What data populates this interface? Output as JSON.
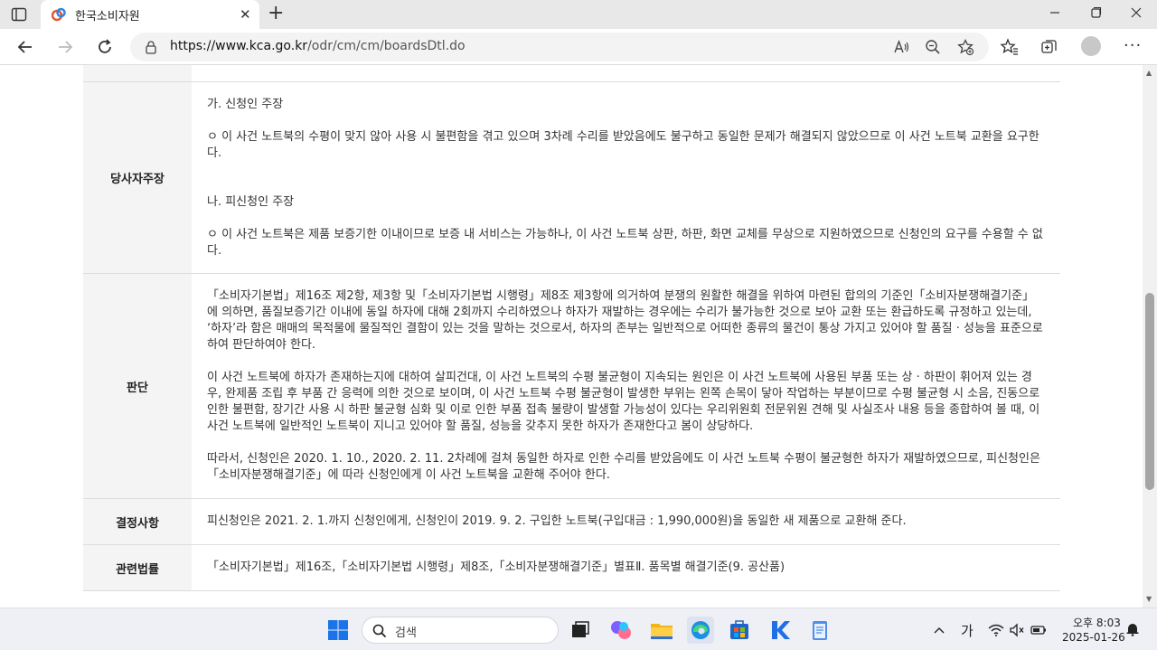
{
  "browser": {
    "tab_title": "한국소비자원",
    "tab_close": "✕",
    "new_tab": "+",
    "url_domain": "https://www.kca.go.kr",
    "url_path": "/odr/cm/cm/boardsDtl.do",
    "more": "···"
  },
  "table": {
    "rows": [
      {
        "label": "당사자주장",
        "paragraphs": [
          "가. 신청인 주장",
          "ㅇ 이 사건 노트북의 수평이 맞지 않아 사용 시 불편함을 겪고 있으며 3차례 수리를 받았음에도 불구하고 동일한 문제가 해결되지 않았으므로 이 사건 노트북 교환을 요구한다.",
          "나. 피신청인 주장",
          "ㅇ 이 사건 노트북은 제품 보증기한 이내이므로 보증 내 서비스는 가능하나, 이 사건 노트북 상판, 하판, 화면 교체를 무상으로 지원하였으므로 신청인의 요구를 수용할 수 없다."
        ]
      },
      {
        "label": "판단",
        "paragraphs": [
          "「소비자기본법」제16조 제2항, 제3항 및「소비자기본법 시행령」제8조 제3항에 의거하여 분쟁의 원활한 해결을 위하여 마련된 합의의 기준인「소비자분쟁해결기준」에 의하면, 품질보증기간 이내에 동일 하자에 대해 2회까지 수리하였으나 하자가 재발하는 경우에는 수리가 불가능한 것으로 보아 교환 또는 환급하도록 규정하고 있는데, ‘하자’라 함은 매매의 목적물에 물질적인 결함이 있는 것을 말하는 것으로서, 하자의 존부는 일반적으로 어떠한 종류의 물건이 통상 가지고 있어야 할 품질 · 성능을 표준으로 하여 판단하여야 한다.",
          "이 사건 노트북에 하자가 존재하는지에 대하여 살피건대, 이 사건 노트북의 수평 불균형이 지속되는 원인은 이 사건 노트북에 사용된 부품 또는 상 · 하판이 휘어져 있는 경우, 완제품 조립 후 부품 간 응력에 의한 것으로 보이며, 이 사건 노트북 수평 불균형이 발생한 부위는 왼쪽 손목이 닿아 작업하는 부분이므로 수평 불균형 시 소음, 진동으로 인한 불편함, 장기간 사용 시 하판 불균형 심화 및 이로 인한 부품 접촉 불량이 발생할 가능성이 있다는 우리위원회 전문위원 견해 및 사실조사 내용 등을 종합하여 볼 때, 이 사건 노트북에 일반적인 노트북이 지니고 있어야 할 품질, 성능을 갖추지 못한 하자가 존재한다고 봄이 상당하다.",
          "따라서, 신청인은 2020. 1. 10., 2020. 2. 11. 2차례에 걸쳐 동일한 하자로 인한 수리를 받았음에도 이 사건 노트북 수평이 불균형한 하자가 재발하였으므로, 피신청인은「소비자분쟁해결기준」에 따라 신청인에게 이 사건 노트북을 교환해 주어야 한다."
        ]
      },
      {
        "label": "결정사항",
        "paragraphs": [
          "피신청인은 2021. 2. 1.까지 신청인에게, 신청인이 2019. 9. 2. 구입한 노트북(구입대금 : 1,990,000원)을 동일한 새 제품으로 교환해 준다."
        ]
      },
      {
        "label": "관련법률",
        "paragraphs": [
          "「소비자기본법」제16조,「소비자기본법 시행령」제8조,「소비자분쟁해결기준」별표Ⅱ. 품목별 해결기준(9. 공산품)"
        ]
      }
    ]
  },
  "taskbar": {
    "search_placeholder": "검색",
    "ime": "가",
    "time": "오후 8:03",
    "date": "2025-01-26"
  }
}
